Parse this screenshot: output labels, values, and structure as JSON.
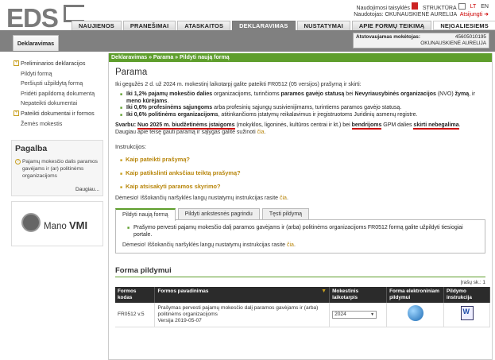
{
  "header": {
    "logo_text": "EDS",
    "top_links": {
      "help": "Naudojimosi taisyklės",
      "structure": "STRUKTŪRA",
      "lang_lt": "LT",
      "lang_en": "EN"
    },
    "user_label": "Naudotojas: OKUNAUSKIENĖ AURELIJA",
    "logout": "Atsijungti"
  },
  "nav": {
    "tabs": [
      {
        "label": "NAUJIENOS"
      },
      {
        "label": "PRANEŠIMAI"
      },
      {
        "label": "ATASKAITOS"
      },
      {
        "label": "DEKLARAVIMAS"
      },
      {
        "label": "NUSTATYMAI"
      },
      {
        "label": "APIE FORMŲ TEIKIMĄ"
      },
      {
        "label": "NEĮGALIESIEMS"
      }
    ]
  },
  "subtab": "Deklaravimas",
  "represented": {
    "label": "Atstovaujamas mokėtojas:",
    "code": "45605010195",
    "name": "OKUNAUSKIENĖ AURELIJA"
  },
  "sidebar": {
    "items": [
      {
        "label": "Preliminarios deklaracijos"
      },
      {
        "label": "Pildyti formą"
      },
      {
        "label": "Peršiųsti užpildytą formą"
      },
      {
        "label": "Pridėti papildomą dokumentą"
      },
      {
        "label": "Nepateikti dokumentai"
      },
      {
        "label": "Pateikti dokumentai ir formos"
      },
      {
        "label": "Žemės mokestis"
      }
    ],
    "help_title": "Pagalba",
    "help_text": "Pajamų mokesčio dalis paramos gavėjams ir (ar) politinėms organizacijoms",
    "help_more": "Daugiau...",
    "vmi_prefix": "Mano",
    "vmi_suffix": "VMI"
  },
  "main": {
    "breadcrumb": "Deklaravimas » Parama » Pildyti naują formą",
    "title": "Parama",
    "intro": "Iki gegužės 2 d. už 2024 m. mokestinį laikotarpį galite pateikti FR0512 (05 versijos) prašymą ir skirti:",
    "bullets": [
      {
        "bold": "Iki 1,2% pajamų mokesčio dalies",
        "rest": " organizacijoms, turinčioms ",
        "bold2": "paramos gavėjo statusą",
        "rest2": " bei ",
        "bold3": "Nevyriausybinės organizacijos",
        "rest3": " (NVO) ",
        "bold4": "žymą",
        "rest4": ", ir ",
        "bold5": "meno kūrėjams",
        "rest5": "."
      },
      {
        "bold": "Iki 0,6% profesinėms sąjungoms",
        "rest": " arba profesinių sąjungų susivienijimams, turintiems paramos gavėjo statusą."
      },
      {
        "bold": "Iki 0,6% politinėms organizacijoms",
        "rest": ", atitinkančioms įstatymų reikalavimus ir įregistruotoms Juridinių asmenų registre."
      }
    ],
    "important_label": "Svarbu: ",
    "important_u1": "Nuo 2025 m. biudžetinėms įstaigoms",
    "important_mid": " (mokyklos, ligoninės, kultūros centrai ir kt.) bei ",
    "important_u2": "bendrijoms",
    "important_mid2": " GPM dalies ",
    "important_u3": "skirti nebegalima",
    "important_end": ".",
    "more_info": "Daugiau apie teisę gauti paramą ir sąlygas galite sužinoti ",
    "more_link": "čia",
    "instructions_title": "Instrukcijos:",
    "instructions": [
      {
        "label": "Kaip pateikti prašymą?"
      },
      {
        "label": "Kaip patikslinti anksčiau teiktą prašymą?"
      },
      {
        "label": "Kaip atsisakyti paramos skyrimo?"
      }
    ],
    "attention": "Dėmesio! Iššokančių naršyklės langų nustatymų instrukcijas rasite ",
    "attention_link": "čia",
    "form_tabs": [
      {
        "label": "Pildyti naują formą"
      },
      {
        "label": "Pildyti ankstesnės pagrindu"
      },
      {
        "label": "Tęsti pildymą"
      }
    ],
    "panel_text": "Prašymo pervesti pajamų mokesčio dalį paramos gavėjams ir (arba) politinėms organizacijoms FR0512 formą galite užpildyti tiesiogiai portale.",
    "panel_attention": "Dėmesio! Iššokančių naršyklės langų nustatymų instrukcijas rasite ",
    "panel_attention_link": "čia",
    "section_title": "Forma pildymui",
    "record_count": "Įrašų sk.: 1",
    "table": {
      "headers": [
        "Formos kodas",
        "Formos pavadinimas",
        "Mokestinis laikotarpis",
        "Forma elektroniniam pildymui",
        "Pildymo instrukcija"
      ],
      "rows": [
        {
          "code": "FR0512 v.5",
          "name": "Prašymas pervesti pajamų mokesčio dalį paramos gavėjams ir (arba) politinėms organizacijoms",
          "version": "Versija 2019-05-07",
          "period": "2024"
        }
      ]
    }
  }
}
